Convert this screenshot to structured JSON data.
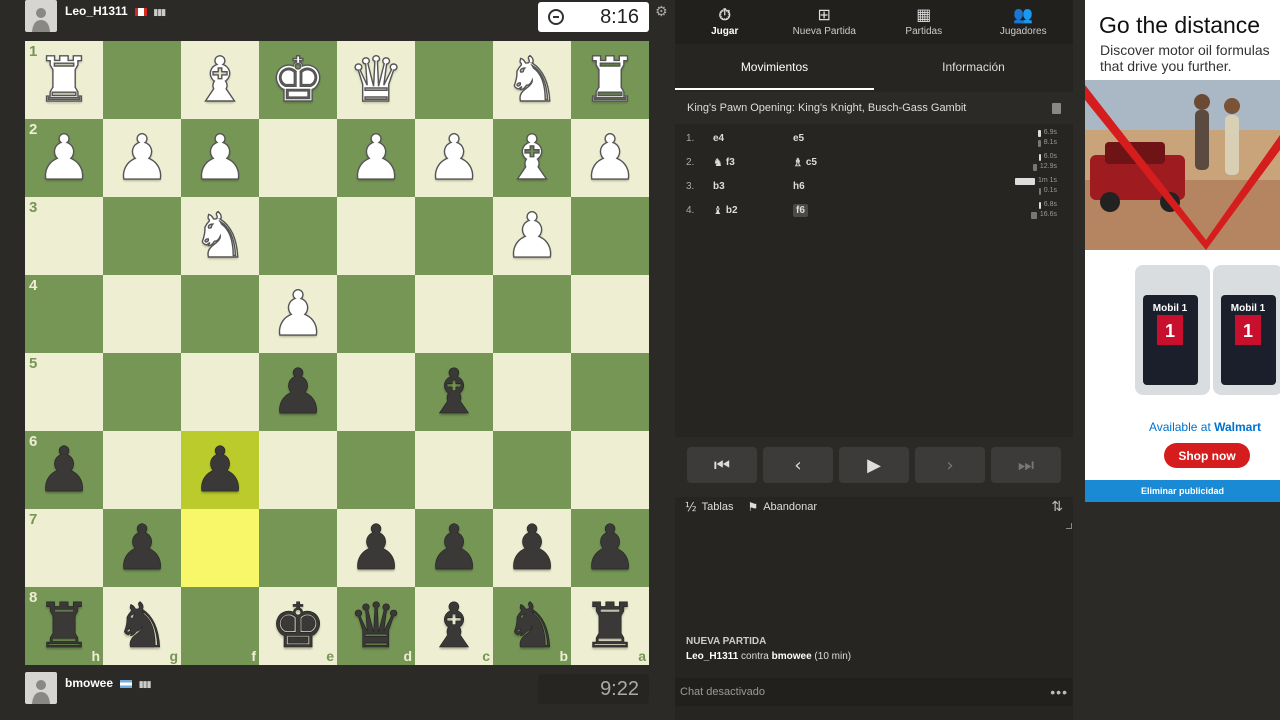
{
  "players": {
    "top": {
      "name": "Leo_H1311",
      "clock": "8:16",
      "bars": "▮▮▮"
    },
    "bottom": {
      "name": "bmowee",
      "clock": "9:22",
      "bars": "▮▮▮"
    }
  },
  "board": {
    "orientation": "black",
    "ranks": [
      "1",
      "2",
      "3",
      "4",
      "5",
      "6",
      "7",
      "8"
    ],
    "files": [
      "h",
      "g",
      "f",
      "e",
      "d",
      "c",
      "b",
      "a"
    ],
    "rows": [
      [
        "R",
        "",
        "B",
        "K",
        "Q",
        "",
        "N",
        "R"
      ],
      [
        "P",
        "P",
        "P",
        "",
        "P",
        "P",
        "B",
        "P"
      ],
      [
        "",
        "",
        "N",
        "",
        "",
        "",
        "P",
        ""
      ],
      [
        "",
        "",
        "",
        "P",
        "",
        "",
        "",
        ""
      ],
      [
        "",
        "",
        "",
        "p",
        "",
        "b",
        "",
        ""
      ],
      [
        "p",
        "",
        "p",
        "",
        "",
        "",
        "",
        ""
      ],
      [
        "",
        "p",
        "",
        "",
        "p",
        "p",
        "p",
        "p"
      ],
      [
        "r",
        "n",
        "",
        "k",
        "q",
        "b",
        "n",
        "r"
      ]
    ],
    "highlights": [
      [
        5,
        2
      ],
      [
        6,
        2
      ]
    ]
  },
  "nav": [
    {
      "label": "Jugar",
      "icon": "stopwatch-icon"
    },
    {
      "label": "Nueva Partida",
      "icon": "plus-square-icon"
    },
    {
      "label": "Partidas",
      "icon": "board-icon"
    },
    {
      "label": "Jugadores",
      "icon": "users-icon"
    }
  ],
  "tabs": [
    "Movimientos",
    "Información"
  ],
  "opening": "King's Pawn Opening: King's Knight, Busch-Gass Gambit",
  "moves": [
    {
      "num": "1.",
      "white": "e4",
      "white_piece": "",
      "black": "e5",
      "black_piece": "",
      "wt": "6.9s",
      "bt": "8.1s"
    },
    {
      "num": "2.",
      "white": "f3",
      "white_piece": "knight",
      "black": "c5",
      "black_piece": "bishop",
      "wt": "6.0s",
      "bt": "12.9s"
    },
    {
      "num": "3.",
      "white": "b3",
      "white_piece": "",
      "black": "h6",
      "black_piece": "",
      "wt": "1m 1s",
      "bt": "0.1s"
    },
    {
      "num": "4.",
      "white": "b2",
      "white_piece": "bishop",
      "black": "f6",
      "black_piece": "",
      "wt": "6.8s",
      "bt": "16.6s"
    }
  ],
  "actions": {
    "draw_label": "Tablas",
    "draw_icon": "½",
    "resign_label": "Abandonar"
  },
  "new_game": {
    "heading": "NUEVA PARTIDA",
    "player1": "Leo_H1311",
    "vs": "contra",
    "player2": "bmowee",
    "control": "(10 min)"
  },
  "chat": {
    "status": "Chat desactivado"
  },
  "ad": {
    "title": "Go the distance",
    "subtitle": "Discover motor oil formulas that drive you further.",
    "available": "Available at",
    "retailer": "Walmart",
    "cta": "Shop now",
    "remove": "Eliminar publicidad",
    "brand": "Mobil 1"
  },
  "colors": {
    "light_square": "#eeeed2",
    "dark_square": "#769656",
    "highlight": "#f7f769",
    "accent_red": "#d51d1d"
  }
}
